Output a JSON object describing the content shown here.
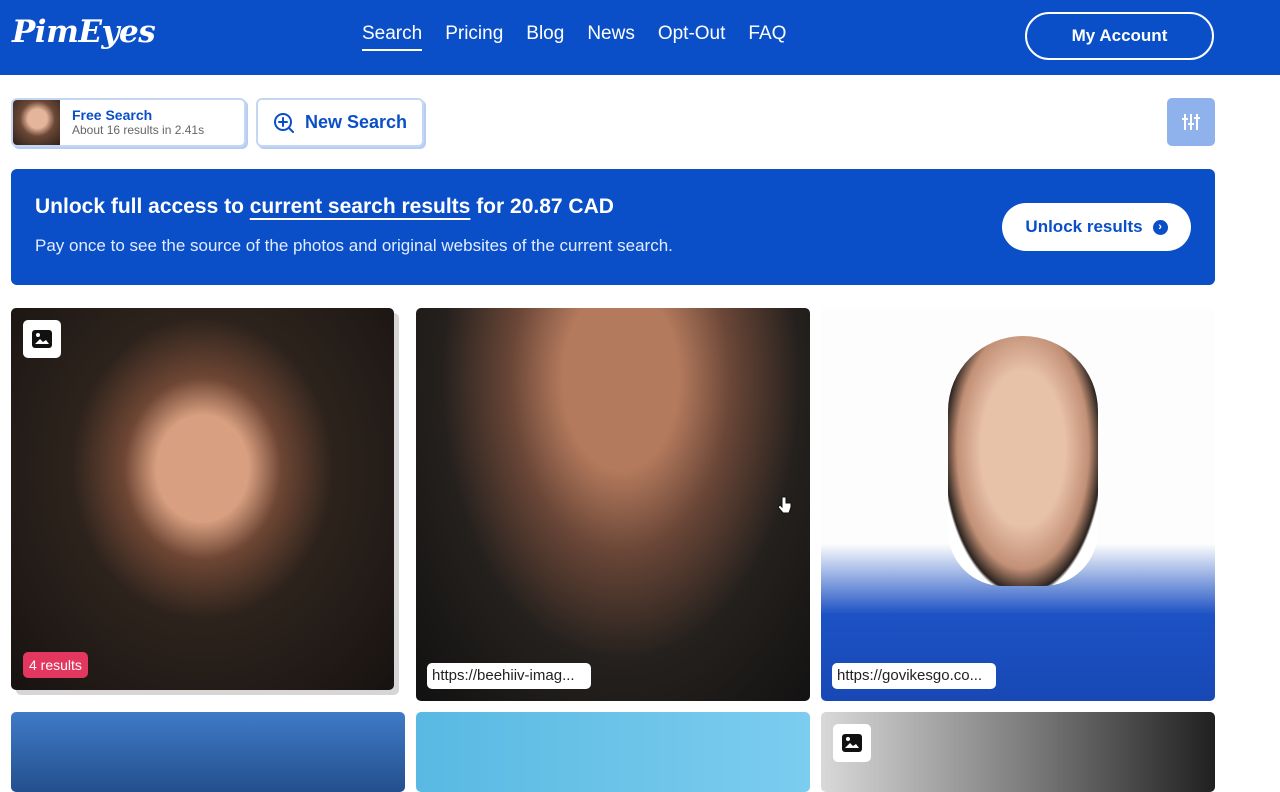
{
  "brand": {
    "logo_text": "PimEyes"
  },
  "nav": {
    "items": [
      {
        "label": "Search",
        "active": true
      },
      {
        "label": "Pricing"
      },
      {
        "label": "Blog"
      },
      {
        "label": "News"
      },
      {
        "label": "Opt-Out"
      },
      {
        "label": "FAQ"
      }
    ],
    "account_label": "My Account"
  },
  "search_chip": {
    "title": "Free Search",
    "subtitle": "About 16 results in 2.41s"
  },
  "new_search": {
    "label": "New Search"
  },
  "banner": {
    "title_prefix": "Unlock full access to ",
    "title_link": "current search results",
    "title_suffix": " for 20.87 CAD",
    "subtitle": "Pay once to see the source of the photos and original websites of the current search.",
    "button_label": "Unlock results"
  },
  "results": [
    {
      "badge": "4 results",
      "has_image_icon": true
    },
    {
      "url": "https://beehiiv-imag..."
    },
    {
      "url": "https://govikesgo.co..."
    },
    {},
    {},
    {
      "has_image_icon": true
    }
  ],
  "colors": {
    "brand_blue": "#0a4fc8",
    "badge_pink": "#e3375f",
    "filter_button": "#8fb2ec"
  }
}
